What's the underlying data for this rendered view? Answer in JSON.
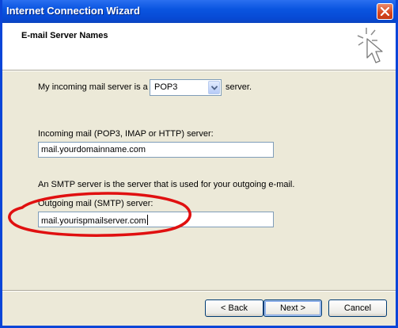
{
  "window": {
    "title": "Internet Connection Wizard"
  },
  "header": {
    "title": "E-mail Server Names"
  },
  "incoming_type": {
    "prefix": "My incoming mail server is a",
    "selected": "POP3",
    "suffix": "server."
  },
  "incoming_server": {
    "label": "Incoming mail (POP3, IMAP or HTTP) server:",
    "value": "mail.yourdomainname.com"
  },
  "smtp_info": "An SMTP server is the server that is used for your outgoing e-mail.",
  "outgoing_server": {
    "label": "Outgoing mail (SMTP) server:",
    "value": "mail.yourispmailserver.com"
  },
  "buttons": {
    "back": "< Back",
    "next": "Next >",
    "cancel": "Cancel"
  },
  "colors": {
    "titlebar": "#0a55e0",
    "annotation": "#e01010",
    "dialog_bg": "#ece9d8"
  }
}
